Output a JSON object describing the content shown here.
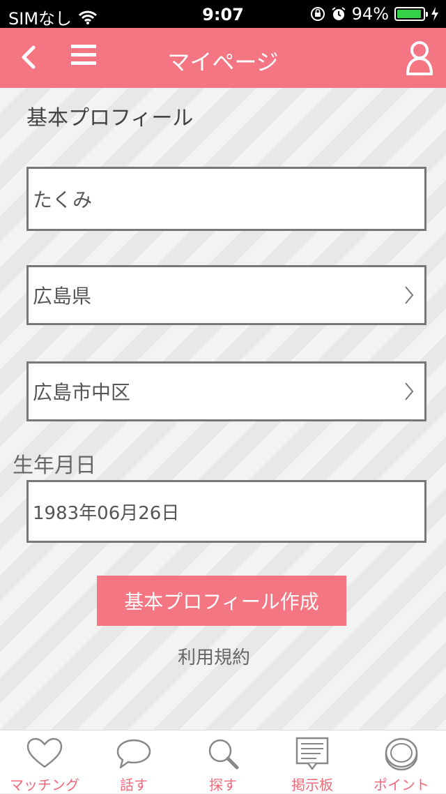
{
  "status_bar": {
    "carrier": "SIMなし",
    "time": "9:07",
    "battery_percent": "94%",
    "battery_level": 0.94
  },
  "nav": {
    "title": "マイページ"
  },
  "profile": {
    "section_title": "基本プロフィール",
    "name_value": "たくみ",
    "prefecture_value": "広島県",
    "city_value": "広島市中区",
    "birthdate_label": "生年月日",
    "birthdate_value": "1983年06月26日",
    "submit_label": "基本プロフィール作成",
    "terms_label": "利用規約"
  },
  "tabs": [
    {
      "label": "マッチング",
      "icon": "heart-icon"
    },
    {
      "label": "話す",
      "icon": "speech-bubble-icon"
    },
    {
      "label": "探す",
      "icon": "search-icon"
    },
    {
      "label": "掲示板",
      "icon": "board-icon"
    },
    {
      "label": "ポイント",
      "icon": "coin-icon"
    }
  ],
  "colors": {
    "accent": "#f47682",
    "tab_label": "#f06a7a",
    "battery": "#35d04a"
  }
}
